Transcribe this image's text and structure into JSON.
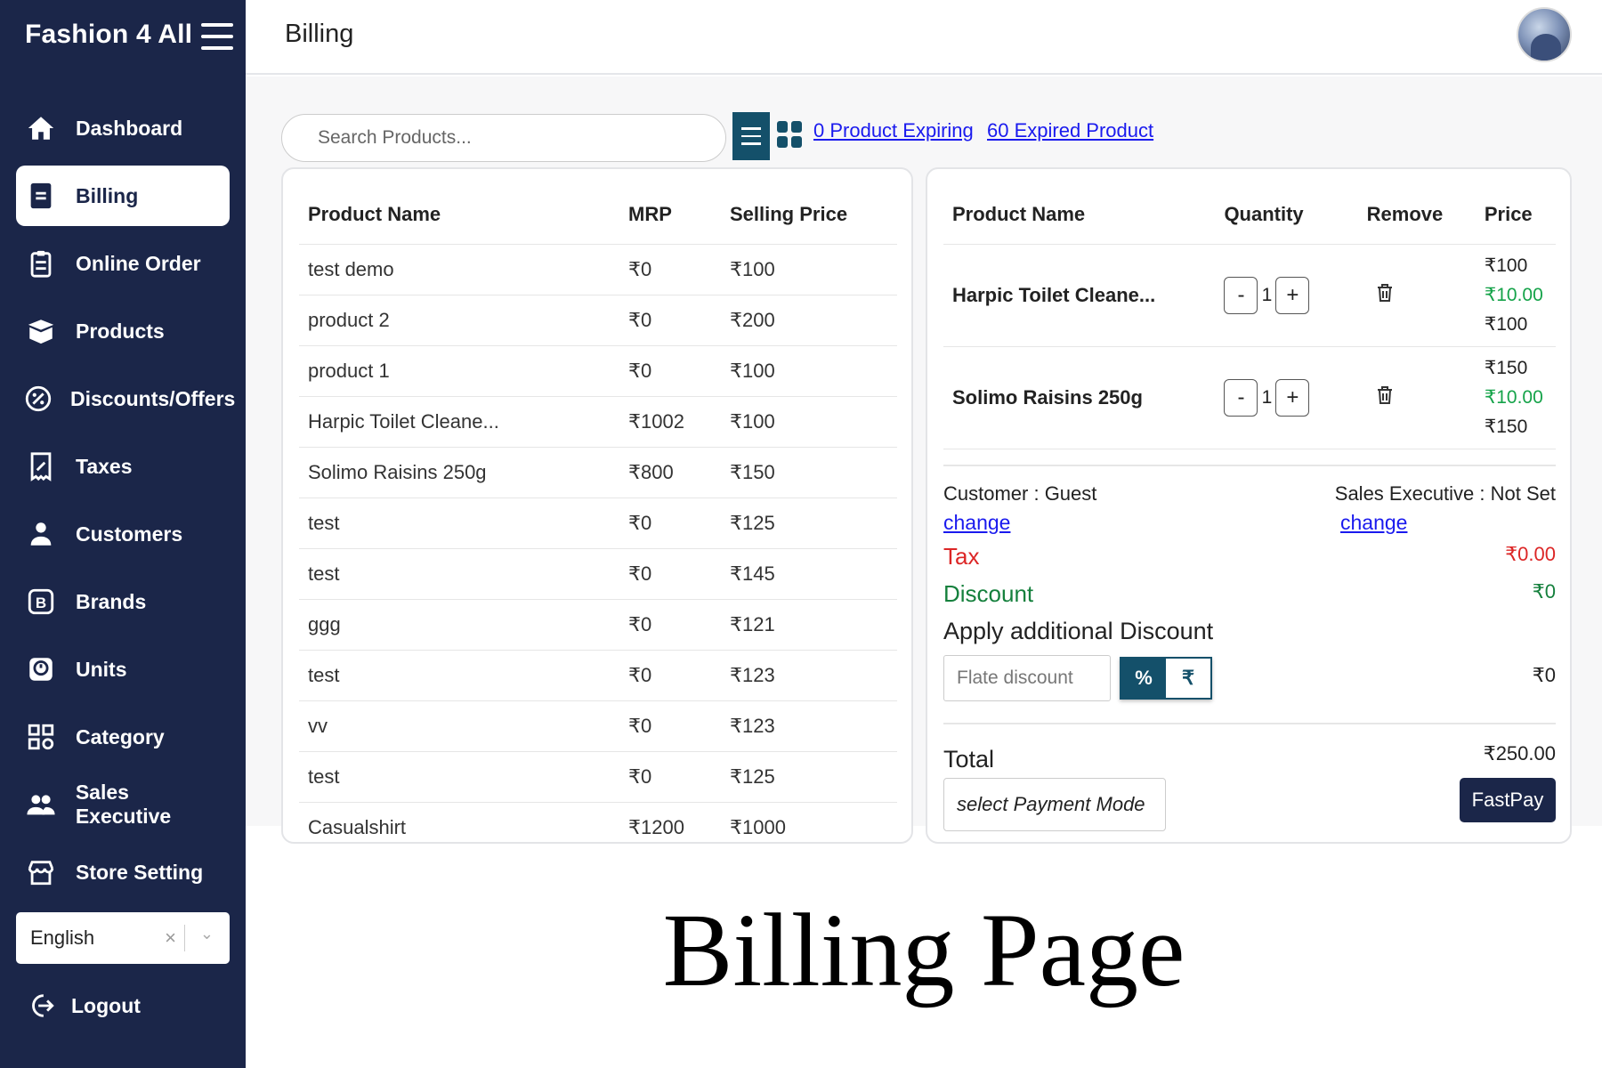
{
  "app": {
    "name": "Fashion 4 All"
  },
  "sidebar": {
    "items": [
      {
        "label": "Dashboard",
        "icon": "home-icon"
      },
      {
        "label": "Billing",
        "icon": "billing-icon"
      },
      {
        "label": "Online Order",
        "icon": "clipboard-icon"
      },
      {
        "label": "Products",
        "icon": "box-icon"
      },
      {
        "label": "Discounts/Offers",
        "icon": "discount-icon"
      },
      {
        "label": "Taxes",
        "icon": "receipt-icon"
      },
      {
        "label": "Customers",
        "icon": "user-icon"
      },
      {
        "label": "Brands",
        "icon": "brand-icon"
      },
      {
        "label": "Units",
        "icon": "units-icon"
      },
      {
        "label": "Category",
        "icon": "category-icon"
      },
      {
        "label": "Sales Executive",
        "icon": "users-icon"
      },
      {
        "label": "Store Setting",
        "icon": "store-icon"
      }
    ],
    "active": "Billing",
    "language": "English",
    "language_clear": "×",
    "language_chevron": "⌄",
    "logout": "Logout"
  },
  "header": {
    "title": "Billing"
  },
  "search": {
    "placeholder": "Search Products..."
  },
  "links": {
    "expiring": "0 Product Expiring",
    "expired": "60 Expired Product"
  },
  "products": {
    "headers": [
      "Product Name",
      "MRP",
      "Selling Price"
    ],
    "rows": [
      [
        "test demo",
        "₹0",
        "₹100"
      ],
      [
        "product 2",
        "₹0",
        "₹200"
      ],
      [
        "product 1",
        "₹0",
        "₹100"
      ],
      [
        "Harpic Toilet Cleane...",
        "₹1002",
        "₹100"
      ],
      [
        "Solimo Raisins 250g",
        "₹800",
        "₹150"
      ],
      [
        "test",
        "₹0",
        "₹125"
      ],
      [
        "test",
        "₹0",
        "₹145"
      ],
      [
        "ggg",
        "₹0",
        "₹121"
      ],
      [
        "test",
        "₹0",
        "₹123"
      ],
      [
        "vv",
        "₹0",
        "₹123"
      ],
      [
        "test",
        "₹0",
        "₹125"
      ],
      [
        "Casualshirt",
        "₹1200",
        "₹1000"
      ]
    ]
  },
  "cart": {
    "headers": [
      "Product Name",
      "Quantity",
      "Remove",
      "Price"
    ],
    "minus": "-",
    "plus": "+",
    "items": [
      {
        "name": "Harpic Toilet Cleane...",
        "qty": "1",
        "price_top": "₹100",
        "price_mid": "₹10.00",
        "price_bottom": "₹100"
      },
      {
        "name": "Solimo Raisins 250g",
        "qty": "1",
        "price_top": "₹150",
        "price_mid": "₹10.00",
        "price_bottom": "₹150"
      }
    ],
    "customer": "Customer : Guest",
    "customer_change": "change",
    "sales_exec": "Sales Executive : Not Set",
    "sales_change": "change",
    "tax_label": "Tax",
    "tax_value": "₹0.00",
    "discount_label": "Discount",
    "discount_value": "₹0",
    "additional_label": "Apply additional Discount",
    "flat_placeholder": "Flate discount",
    "toggle_percent": "%",
    "toggle_rupee": "₹",
    "additional_value": "₹0",
    "total_label": "Total",
    "total_value": "₹250.00",
    "payment_mode": "select Payment Mode",
    "fastpay": "FastPay"
  },
  "caption": "Billing Page",
  "colors": {
    "sidebar": "#1b2649",
    "accent": "#14506a",
    "tax": "#dc2626",
    "discount": "#15803d",
    "link": "#1a1aee"
  }
}
